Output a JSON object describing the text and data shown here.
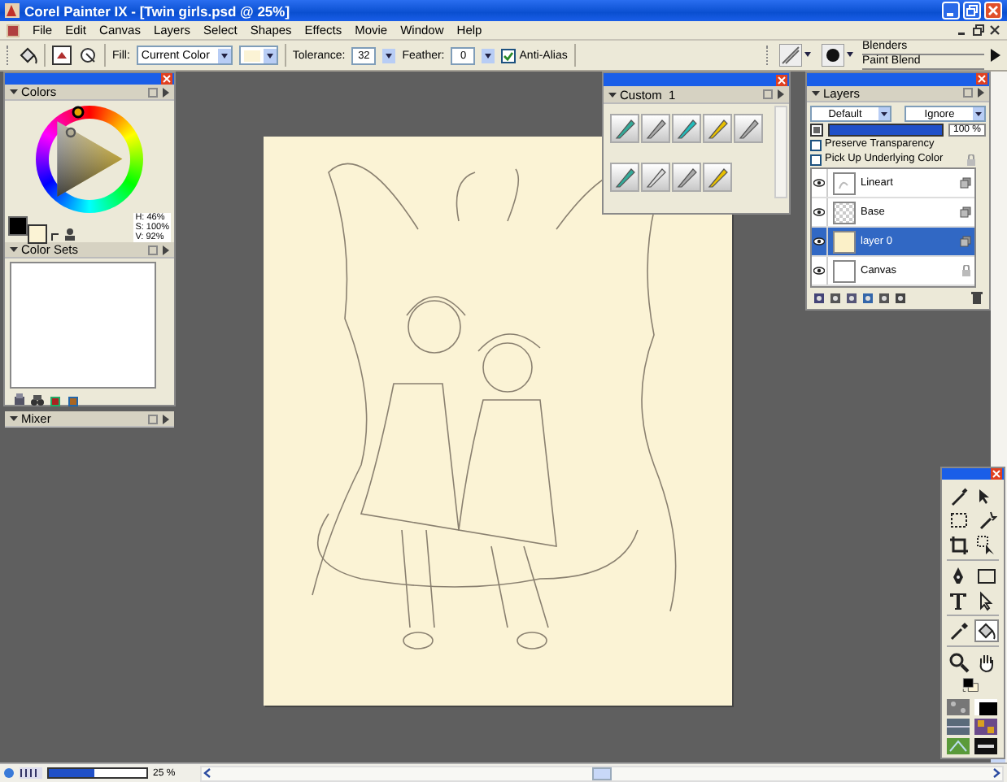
{
  "window": {
    "title": "Corel Painter IX - [Twin girls.psd @ 25%]"
  },
  "menu": [
    "File",
    "Edit",
    "Canvas",
    "Layers",
    "Select",
    "Shapes",
    "Effects",
    "Movie",
    "Window",
    "Help"
  ],
  "toolbar": {
    "fill_label": "Fill:",
    "fill_value": "Current Color",
    "fill_color": {
      "color": "#fbf3d5"
    },
    "tolerance_label": "Tolerance:",
    "tolerance": "32",
    "feather_label": "Feather:",
    "feather": "0",
    "anti_alias": {
      "label": "Anti-Alias",
      "checked": true
    }
  },
  "brush_selector": {
    "category": "Blenders",
    "variant": "Paint Blend"
  },
  "colors_panel": {
    "title": "Colors",
    "swatches": [
      {
        "kind": "primary",
        "color": "#000000"
      },
      {
        "kind": "secondary",
        "color": "#fbf3d5"
      }
    ],
    "readout": [
      "H: 46%",
      "S: 100%",
      "V: 92%"
    ]
  },
  "color_sets_panel": {
    "title": "Color Sets"
  },
  "mixer_panel": {
    "title": "Mixer"
  },
  "custom_palette": {
    "title": "Custom  1"
  },
  "layers_panel": {
    "title": "Layers",
    "composite_method": "Default",
    "composite_depth": "Ignore",
    "opacity": {
      "level": 1.0,
      "reading": "100 %"
    },
    "options": [
      {
        "label": "Preserve Transparency",
        "checked": false
      },
      {
        "label": "Pick Up Underlying Color",
        "checked": false
      }
    ],
    "layers": [
      {
        "name": "Lineart",
        "kind": "sketch",
        "visible": true,
        "selected": false,
        "locked": false
      },
      {
        "name": "Base",
        "kind": "transparent",
        "visible": true,
        "selected": false,
        "locked": false
      },
      {
        "name": "layer 0",
        "kind": "fill",
        "visible": true,
        "selected": true,
        "locked": false
      },
      {
        "name": "Canvas",
        "kind": "canvas",
        "visible": true,
        "selected": false,
        "locked": true
      }
    ]
  },
  "toolbox": [
    {
      "kind": "brush",
      "selected": false
    },
    {
      "kind": "layer-adjuster",
      "selected": false
    },
    {
      "kind": "rect-select",
      "selected": false
    },
    {
      "kind": "wand",
      "selected": false
    },
    {
      "kind": "crop",
      "selected": false
    },
    {
      "kind": "transform",
      "selected": false
    },
    {
      "kind": "pen",
      "selected": false
    },
    {
      "kind": "rectangle",
      "selected": false
    },
    {
      "kind": "text",
      "selected": false
    },
    {
      "kind": "shape-select",
      "selected": false
    },
    {
      "kind": "dropper",
      "selected": false
    },
    {
      "kind": "bucket",
      "selected": true
    },
    {
      "kind": "magnifier",
      "selected": false
    },
    {
      "kind": "grabber",
      "selected": false
    }
  ],
  "status_bar": {
    "zoom": {
      "level": 0.47,
      "reading": "25 %"
    }
  }
}
